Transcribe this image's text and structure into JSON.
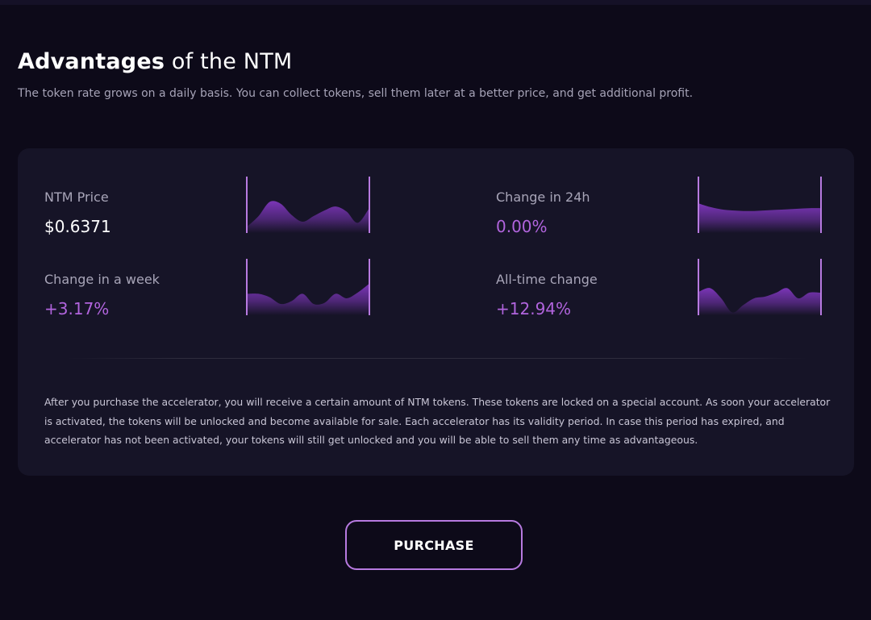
{
  "header": {
    "title_strong": "Advantages",
    "title_rest": " of the NTM",
    "subtitle": "The token rate grows on a daily basis. You can collect tokens, sell them later at a better price, and get additional profit."
  },
  "colors": {
    "background": "#0d0a19",
    "card": "#161427",
    "accent": "#b164dd",
    "chart_fill_top": "#7a35b6",
    "chart_border": "#b77ae0"
  },
  "stats": [
    {
      "label": "NTM Price",
      "value": "$0.6371",
      "value_color": "white",
      "sparkline": [
        0.12,
        0.3,
        0.55,
        0.52,
        0.32,
        0.2,
        0.3,
        0.4,
        0.47,
        0.38,
        0.18,
        0.42
      ]
    },
    {
      "label": "Change in 24h",
      "value": "0.00%",
      "value_color": "purple",
      "sparkline": [
        0.52,
        0.46,
        0.42,
        0.4,
        0.39,
        0.39,
        0.4,
        0.41,
        0.42,
        0.43,
        0.44,
        0.44
      ]
    },
    {
      "label": "Change in a week",
      "value": "+3.17%",
      "value_color": "purple",
      "sparkline": [
        0.38,
        0.38,
        0.32,
        0.2,
        0.25,
        0.38,
        0.2,
        0.22,
        0.38,
        0.3,
        0.4,
        0.55
      ]
    },
    {
      "label": "All-time change",
      "value": "+12.94%",
      "value_color": "purple",
      "sparkline": [
        0.42,
        0.48,
        0.3,
        0.05,
        0.18,
        0.3,
        0.33,
        0.4,
        0.48,
        0.3,
        0.4,
        0.4
      ]
    }
  ],
  "description": "After you purchase the accelerator, you will receive a certain amount of NTM tokens. These tokens are locked on a special account. As soon your accelerator is activated, the tokens will be unlocked and become available for sale. Each accelerator has its validity period. In case this period has expired, and accelerator has not been activated, your tokens will still get unlocked and you will be able to sell them any time as advantageous.",
  "purchase_button": {
    "label": "PURCHASE"
  }
}
